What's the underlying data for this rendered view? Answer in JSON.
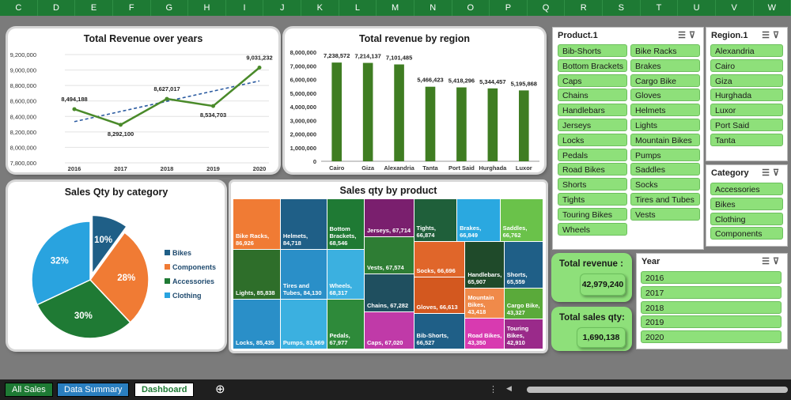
{
  "columns": [
    "C",
    "D",
    "E",
    "F",
    "G",
    "H",
    "I",
    "J",
    "K",
    "L",
    "M",
    "N",
    "O",
    "P",
    "Q",
    "R",
    "S",
    "T",
    "U",
    "V",
    "W"
  ],
  "revenue_years": {
    "title": "Total Revenue over years",
    "chart_data": {
      "type": "line",
      "x": [
        "2016",
        "2017",
        "2018",
        "2019",
        "2020"
      ],
      "values": [
        8494188,
        8292100,
        8627017,
        8534703,
        9031232
      ],
      "labels": [
        "8,494,188",
        "8,292,100",
        "8,627,017",
        "8,534,703",
        "9,031,232"
      ],
      "yticks": [
        "9,200,000",
        "9,000,000",
        "8,800,000",
        "8,600,000",
        "8,400,000",
        "8,200,000",
        "8,000,000",
        "7,800,000"
      ],
      "ylim": [
        7800000,
        9200000
      ],
      "trendline": true,
      "color": "#4a8a2a"
    }
  },
  "revenue_region": {
    "title": "Total revenue by region",
    "chart_data": {
      "type": "bar",
      "categories": [
        "Cairo",
        "Giza",
        "Alexandria",
        "Tanta",
        "Port Said",
        "Hurghada",
        "Luxor"
      ],
      "values": [
        7238572,
        7214137,
        7101485,
        5466423,
        5418296,
        5344457,
        5195868
      ],
      "labels": [
        "7,238,572",
        "7,214,137",
        "7,101,485",
        "5,466,423",
        "5,418,296",
        "5,344,457",
        "5,195,868"
      ],
      "yticks": [
        "8,000,000",
        "7,000,000",
        "6,000,000",
        "5,000,000",
        "4,000,000",
        "3,000,000",
        "2,000,000",
        "1,000,000",
        "0"
      ],
      "ylim": [
        0,
        8000000
      ],
      "color": "#3f7d22"
    }
  },
  "qty_category": {
    "title": "Sales Qty by category",
    "chart_data": {
      "type": "pie",
      "categories": [
        "Bikes",
        "Components",
        "Accessories",
        "Clothing"
      ],
      "values": [
        10,
        28,
        30,
        32
      ],
      "labels": [
        "10%",
        "28%",
        "30%",
        "32%"
      ],
      "colors": [
        "#1f5f87",
        "#f07b34",
        "#1f7a34",
        "#29a3df"
      ],
      "legend": "right"
    }
  },
  "qty_product": {
    "title": "Sales qty by product",
    "chart_data": {
      "type": "treemap",
      "items": [
        {
          "label": "Bike Racks, 86,926",
          "value": 86926,
          "color": "#f07b34"
        },
        {
          "label": "Helmets, 84,718",
          "value": 84718,
          "color": "#1f5f87"
        },
        {
          "label": "Bottom Brackets, 68,546",
          "value": 68546,
          "color": "#1f7a34"
        },
        {
          "label": "Jerseys, 67,714",
          "value": 67714,
          "color": "#7a1f6e"
        },
        {
          "label": "Caps, 67,020",
          "value": 67020,
          "color": "#c03aa8"
        },
        {
          "label": "Tights, 66,874",
          "value": 66874,
          "color": "#1f5f3a"
        },
        {
          "label": "Brakes, 66,849",
          "value": 66849,
          "color": "#2aa8e0"
        },
        {
          "label": "Lights, 85,838",
          "value": 85838,
          "color": "#2e6e2a"
        },
        {
          "label": "Tires and Tubes, 84,130",
          "value": 84130,
          "color": "#2a8fc8"
        },
        {
          "label": "Wheels, 68,317",
          "value": 68317,
          "color": "#3bb0e0"
        },
        {
          "label": "Vests, 67,574",
          "value": 67574,
          "color": "#2e7d34"
        },
        {
          "label": "Saddles, 66,762",
          "value": 66762,
          "color": "#6ac24a"
        },
        {
          "label": "Bib-Shorts, 66,527",
          "value": 66527,
          "color": "#1f5f87"
        },
        {
          "label": "Handlebars, 65,907",
          "value": 65907,
          "color": "#1f4a2a"
        },
        {
          "label": "Gloves, 66,613",
          "value": 66613,
          "color": "#d3581f"
        },
        {
          "label": "Shorts, 65,559",
          "value": 65559,
          "color": "#1f5f87"
        },
        {
          "label": "Road Bikes, 43,350",
          "value": 43350,
          "color": "#d83ab0"
        },
        {
          "label": "Cargo Bike, 43,327",
          "value": 43327,
          "color": "#5aaa3a"
        },
        {
          "label": "Locks, 85,435",
          "value": 85435,
          "color": "#2a8fc8"
        },
        {
          "label": "Pumps, 83,969",
          "value": 83969,
          "color": "#3bb0e0"
        },
        {
          "label": "Pedals, 67,977",
          "value": 67977,
          "color": "#2e8a3a"
        },
        {
          "label": "Chains, 67,282",
          "value": 67282,
          "color": "#1f4f5f"
        },
        {
          "label": "Socks, 66,696",
          "value": 66696,
          "color": "#e0662a"
        },
        {
          "label": "Mountain Bikes, 43,418",
          "value": 43418,
          "color": "#f08a4a"
        },
        {
          "label": "Touring Bikes, 42,910",
          "value": 42910,
          "color": "#9a2a8a"
        }
      ]
    }
  },
  "product_slicer": {
    "title": "Product.1",
    "items": [
      "Bib-Shorts",
      "Bike Racks",
      "Bottom Brackets",
      "Brakes",
      "Caps",
      "Cargo Bike",
      "Chains",
      "Gloves",
      "Handlebars",
      "Helmets",
      "Jerseys",
      "Lights",
      "Locks",
      "Mountain Bikes",
      "Pedals",
      "Pumps",
      "Road Bikes",
      "Saddles",
      "Shorts",
      "Socks",
      "Tights",
      "Tires and Tubes",
      "Touring Bikes",
      "Vests",
      "Wheels"
    ]
  },
  "region_slicer": {
    "title": "Region.1",
    "items": [
      "Alexandria",
      "Cairo",
      "Giza",
      "Hurghada",
      "Luxor",
      "Port Said",
      "Tanta"
    ]
  },
  "category_slicer": {
    "title": "Category",
    "items": [
      "Accessories",
      "Bikes",
      "Clothing",
      "Components"
    ]
  },
  "year_slicer": {
    "title": "Year",
    "items": [
      "2016",
      "2017",
      "2018",
      "2019",
      "2020"
    ]
  },
  "kpi_revenue": {
    "label": "Total revenue :",
    "value": "42,979,240"
  },
  "kpi_qty": {
    "label": "Total sales qty:",
    "value": "1,690,138"
  },
  "sheet_tabs": [
    {
      "label": "All Sales",
      "color": "#1e7a34"
    },
    {
      "label": "Data Summary",
      "color": "#2a7fc0"
    },
    {
      "label": "Dashboard",
      "color": "#ffffff"
    }
  ],
  "add_sheet": "⊕"
}
